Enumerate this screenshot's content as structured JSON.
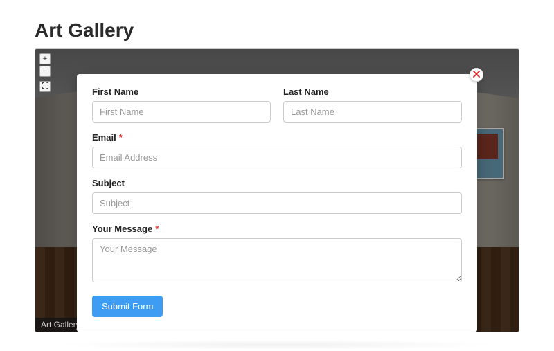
{
  "page": {
    "title": "Art Gallery"
  },
  "viewer": {
    "caption": "Art Gallery",
    "controls": {
      "zoom_in": "+",
      "zoom_out": "−"
    }
  },
  "modal": {
    "fields": {
      "first_name": {
        "label": "First Name",
        "placeholder": "First Name",
        "value": ""
      },
      "last_name": {
        "label": "Last Name",
        "placeholder": "Last Name",
        "value": ""
      },
      "email": {
        "label": "Email",
        "placeholder": "Email Address",
        "value": "",
        "required": true
      },
      "subject": {
        "label": "Subject",
        "placeholder": "Subject",
        "value": ""
      },
      "message": {
        "label": "Your Message",
        "placeholder": "Your Message",
        "value": "",
        "required": true
      }
    },
    "required_marker": "*",
    "submit_label": "Submit Form"
  },
  "colors": {
    "accent": "#3f9cf3",
    "danger": "#e02424"
  }
}
